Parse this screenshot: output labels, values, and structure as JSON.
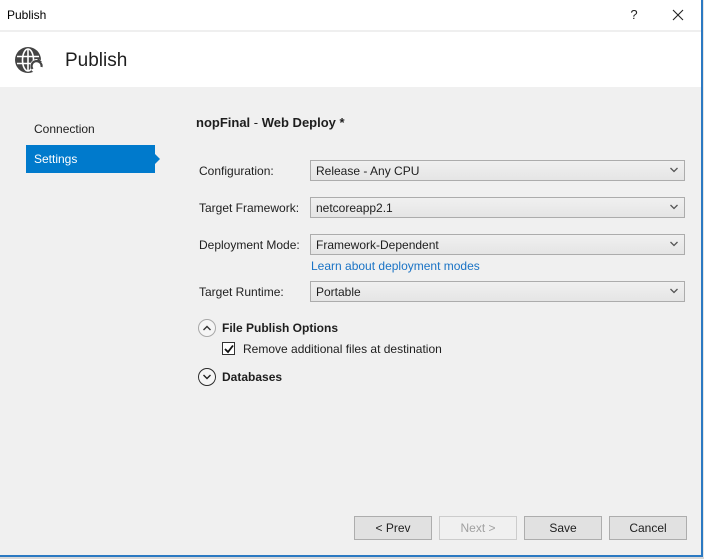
{
  "window": {
    "title": "Publish",
    "help_label": "?",
    "close_icon": "close-icon",
    "accent_color": "#2b79c2"
  },
  "header": {
    "icon": "globe-publish-icon",
    "title": "Publish"
  },
  "nav": {
    "items": [
      {
        "label": "Connection",
        "active": false
      },
      {
        "label": "Settings",
        "active": true
      }
    ],
    "active_color": "#007acc"
  },
  "profile": {
    "name": "nopFinal",
    "separator": " - ",
    "method": "Web Deploy *"
  },
  "form": {
    "configuration": {
      "label": "Configuration:",
      "value": "Release - Any CPU"
    },
    "target_framework": {
      "label": "Target Framework:",
      "value": "netcoreapp2.1"
    },
    "deployment_mode": {
      "label": "Deployment Mode:",
      "value": "Framework-Dependent"
    },
    "deployment_link": "Learn about deployment modes",
    "target_runtime": {
      "label": "Target Runtime:",
      "value": "Portable"
    }
  },
  "sections": {
    "file_publish": {
      "label": "File Publish Options",
      "expanded": true,
      "remove_files": {
        "label": "Remove additional files at destination",
        "checked": true
      }
    },
    "databases": {
      "label": "Databases",
      "expanded": false
    }
  },
  "buttons": {
    "prev": "< Prev",
    "next": "Next >",
    "save": "Save",
    "cancel": "Cancel"
  }
}
